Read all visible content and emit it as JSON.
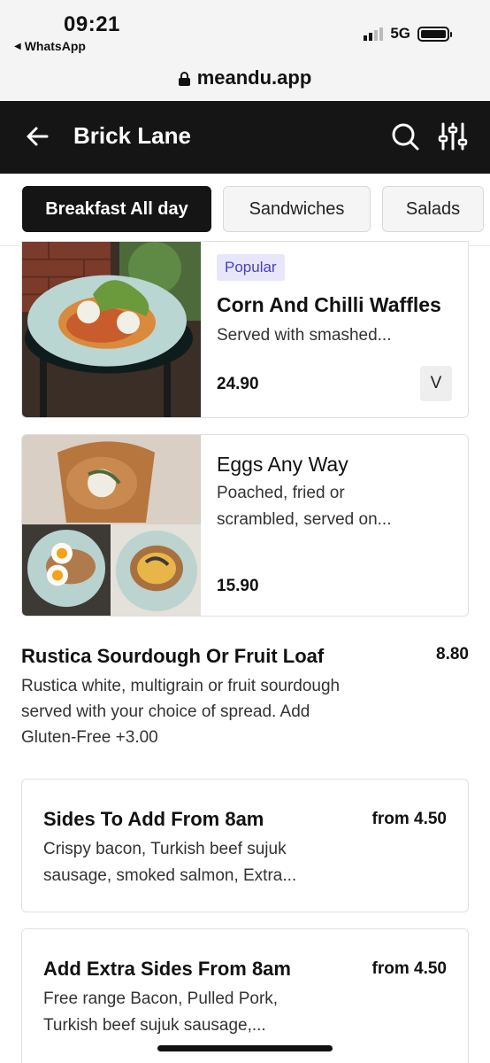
{
  "status": {
    "time": "09:21",
    "back_app": "WhatsApp",
    "network": "5G"
  },
  "browser": {
    "url": "meandu.app"
  },
  "header": {
    "title": "Brick Lane",
    "icons": [
      "back-arrow-icon",
      "search-icon",
      "filter-sliders-icon"
    ]
  },
  "tabs": [
    {
      "label": "Breakfast All day",
      "active": true
    },
    {
      "label": "Sandwiches",
      "active": false
    },
    {
      "label": "Salads",
      "active": false
    }
  ],
  "menu": {
    "items": [
      {
        "badge": "Popular",
        "title": "Corn And Chilli Waffles",
        "description": "Served with smashed...",
        "price": "24.90",
        "dietary_tag": "V"
      },
      {
        "title": "Eggs Any Way",
        "description_line1": "Poached, fried or",
        "description_line2": "scrambled, served on...",
        "price": "15.90"
      }
    ],
    "plain_item": {
      "title": "Rustica Sourdough Or Fruit Loaf",
      "price": "8.80",
      "description_line1": "Rustica white, multigrain or fruit sourdough",
      "description_line2": "served with your choice of spread. Add",
      "description_line3": "Gluten-Free +3.00"
    },
    "side_items": [
      {
        "title": "Sides To Add From 8am",
        "price": "from 4.50",
        "description_line1": "Crispy bacon, Turkish beef sujuk",
        "description_line2": "sausage, smoked salmon, Extra..."
      },
      {
        "title": "Add Extra Sides From 8am",
        "price": "from 4.50",
        "description_line1": "Free range Bacon, Pulled Pork,",
        "description_line2": "Turkish beef sujuk sausage,..."
      }
    ]
  },
  "colors": {
    "header_bg": "#151515",
    "badge_bg": "#e8e6fb",
    "badge_text": "#4a3fbf"
  }
}
